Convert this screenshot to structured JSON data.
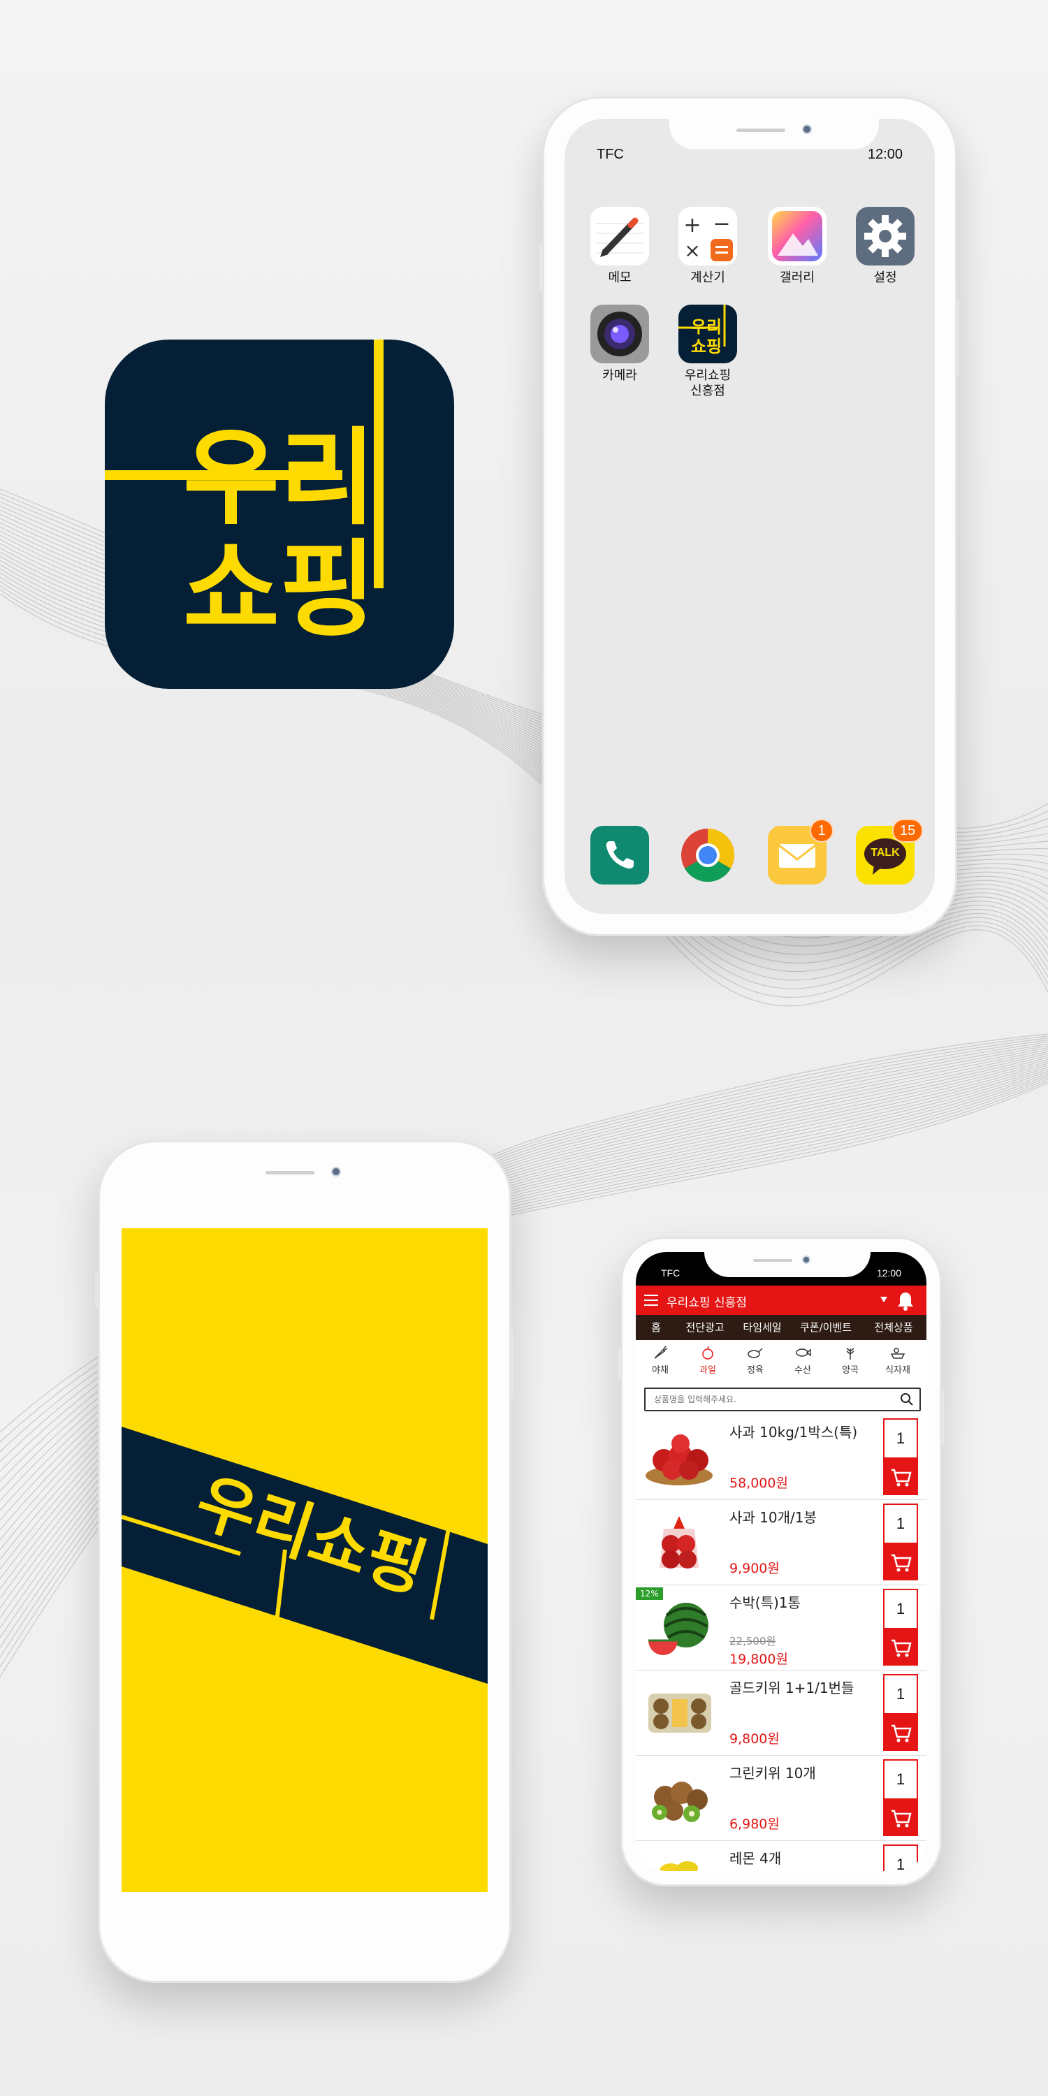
{
  "colors": {
    "navy": "#041f36",
    "yellow": "#fedb00",
    "red": "#e51515",
    "nav_dark": "#2d1b14"
  },
  "logo": {
    "line1": "우리",
    "line2": "쇼핑",
    "banner": "우리쇼핑"
  },
  "home_screen": {
    "status_left": "TFC",
    "status_right": "12:00",
    "apps": [
      {
        "label": "메모",
        "icon": "memo-icon"
      },
      {
        "label": "계산기",
        "icon": "calculator-icon"
      },
      {
        "label": "갤러리",
        "icon": "gallery-icon"
      },
      {
        "label": "설정",
        "icon": "settings-icon"
      },
      {
        "label": "카메라",
        "icon": "camera-icon"
      },
      {
        "label": "우리쇼핑\n신흥점",
        "line1": "우리쇼핑",
        "line2": "신흥점",
        "icon": "wooriShopping-app-icon"
      }
    ],
    "dock": [
      {
        "icon": "phone-icon"
      },
      {
        "icon": "chrome-icon"
      },
      {
        "icon": "mail-icon",
        "badge": "1"
      },
      {
        "icon": "kakaotalk-icon",
        "badge": "15",
        "text": "TALK"
      }
    ]
  },
  "shop_app": {
    "status_left": "TFC",
    "status_right": "12:00",
    "store_name": "우리쇼핑 신흥점",
    "tabs": [
      "홈",
      "전단광고",
      "타임세일",
      "쿠폰/이벤트",
      "전체상품"
    ],
    "active_tab": "홈",
    "categories": [
      {
        "label": "야채",
        "icon": "carrot-icon"
      },
      {
        "label": "과일",
        "icon": "apple-icon"
      },
      {
        "label": "정육",
        "icon": "meat-icon"
      },
      {
        "label": "수산",
        "icon": "fish-icon"
      },
      {
        "label": "양곡",
        "icon": "grain-icon"
      },
      {
        "label": "식자재",
        "icon": "ingredients-icon"
      }
    ],
    "active_category": "과일",
    "search_placeholder": "상품명을 입력해주세요.",
    "products": [
      {
        "name": "사과 10kg/1박스(특)",
        "price": "58,000원",
        "qty": "1"
      },
      {
        "name": "사과 10개/1봉",
        "price": "9,900원",
        "qty": "1"
      },
      {
        "name": "수박(특)1통",
        "old_price": "22,500원",
        "price": "19,800원",
        "discount": "12%",
        "qty": "1"
      },
      {
        "name": "골드키위 1+1/1번들",
        "price": "9,800원",
        "qty": "1"
      },
      {
        "name": "그린키위 10개",
        "price": "6,980원",
        "qty": "1"
      },
      {
        "name": "레몬 4개",
        "price": "",
        "qty": "1"
      }
    ]
  }
}
